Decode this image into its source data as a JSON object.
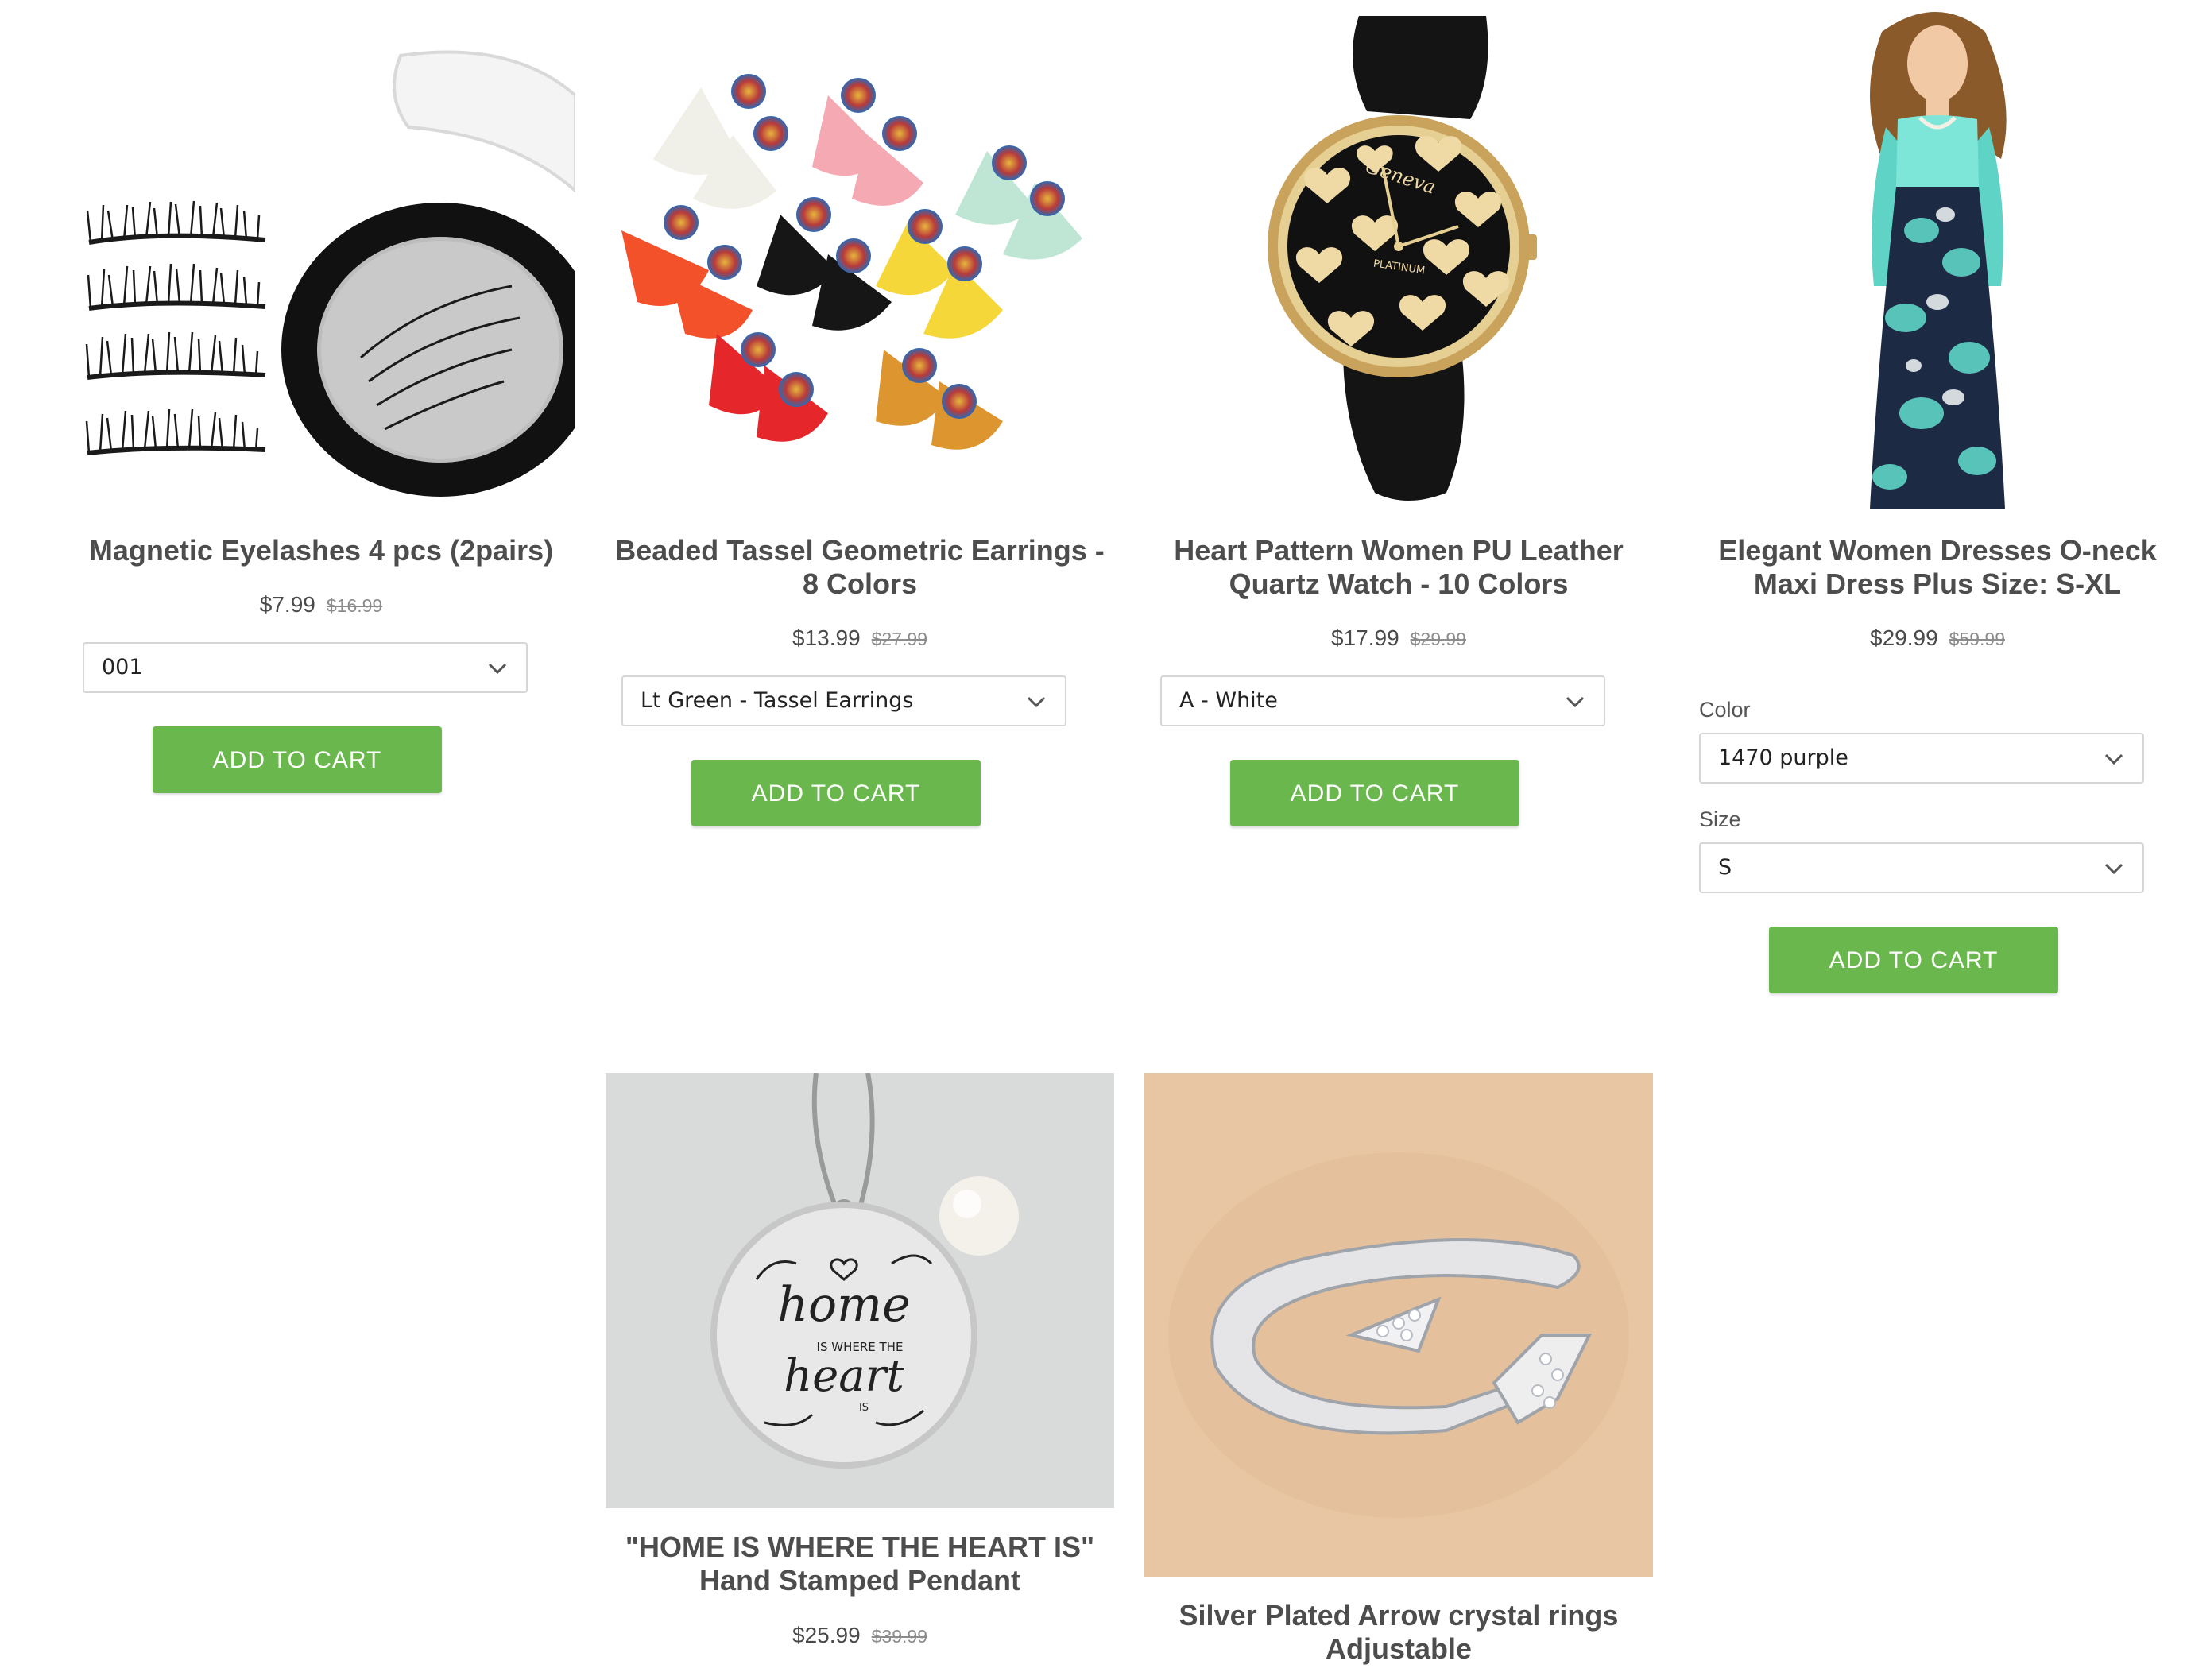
{
  "products": [
    {
      "title": "Magnetic Eyelashes 4 pcs (2pairs)",
      "price": "$7.99",
      "compare_price": "$16.99",
      "variant": "001",
      "button": "ADD TO CART",
      "image_icon": "eyelashes-image"
    },
    {
      "title": "Beaded Tassel Geometric Earrings - 8 Colors",
      "price": "$13.99",
      "compare_price": "$27.99",
      "variant": "Lt Green - Tassel Earrings",
      "button": "ADD TO CART",
      "image_icon": "earrings-image"
    },
    {
      "title": "Heart Pattern Women PU Leather Quartz Watch - 10 Colors",
      "price": "$17.99",
      "compare_price": "$29.99",
      "variant": "A - White",
      "button": "ADD TO CART",
      "image_icon": "watch-image",
      "watch_brand": "Geneva",
      "watch_sub": "PLATINUM"
    },
    {
      "title": "Elegant Women Dresses O-neck Maxi Dress Plus Size: S-XL",
      "price": "$29.99",
      "compare_price": "$59.99",
      "color_label": "Color",
      "color_value": "1470 purple",
      "size_label": "Size",
      "size_value": "S",
      "button": "ADD TO CART",
      "image_icon": "dress-image"
    },
    {
      "title": "\"HOME IS WHERE THE HEART IS\" Hand Stamped Pendant",
      "price": "$25.99",
      "compare_price": "$39.99",
      "image_icon": "pendant-image",
      "engraving": [
        "home",
        "IS WHERE THE",
        "heart",
        "IS"
      ]
    },
    {
      "title": "Silver Plated Arrow crystal rings Adjustable",
      "image_icon": "ring-image"
    }
  ],
  "colors": {
    "button": "#6ab84d",
    "text": "#4d4d4d",
    "compare_price": "#8c8c8c"
  }
}
